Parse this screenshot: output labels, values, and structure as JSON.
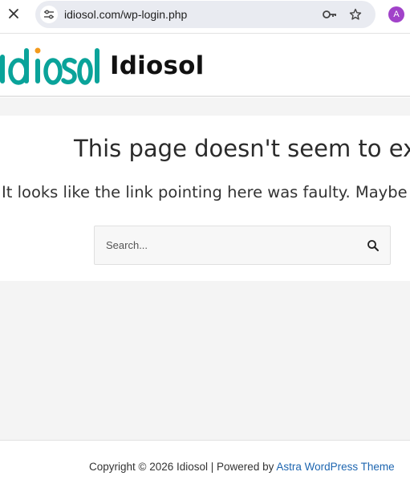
{
  "browser": {
    "url": "idiosol.com/wp-login.php",
    "profile_initial": "A"
  },
  "site": {
    "logo_text": "idiosol",
    "title": "Idiosol"
  },
  "error_page": {
    "heading": "This page doesn't seem to exist.",
    "message": "It looks like the link pointing here was faulty. Maybe try s",
    "search_placeholder": "Search..."
  },
  "footer": {
    "copyright": "Copyright © 2026 Idiosol | Powered by ",
    "link_text": "Astra WordPress Theme"
  },
  "colors": {
    "logo_teal": "#0aa39a",
    "logo_orange": "#f39a1c",
    "link_blue": "#1e66b0",
    "avatar_purple": "#a142c9"
  }
}
